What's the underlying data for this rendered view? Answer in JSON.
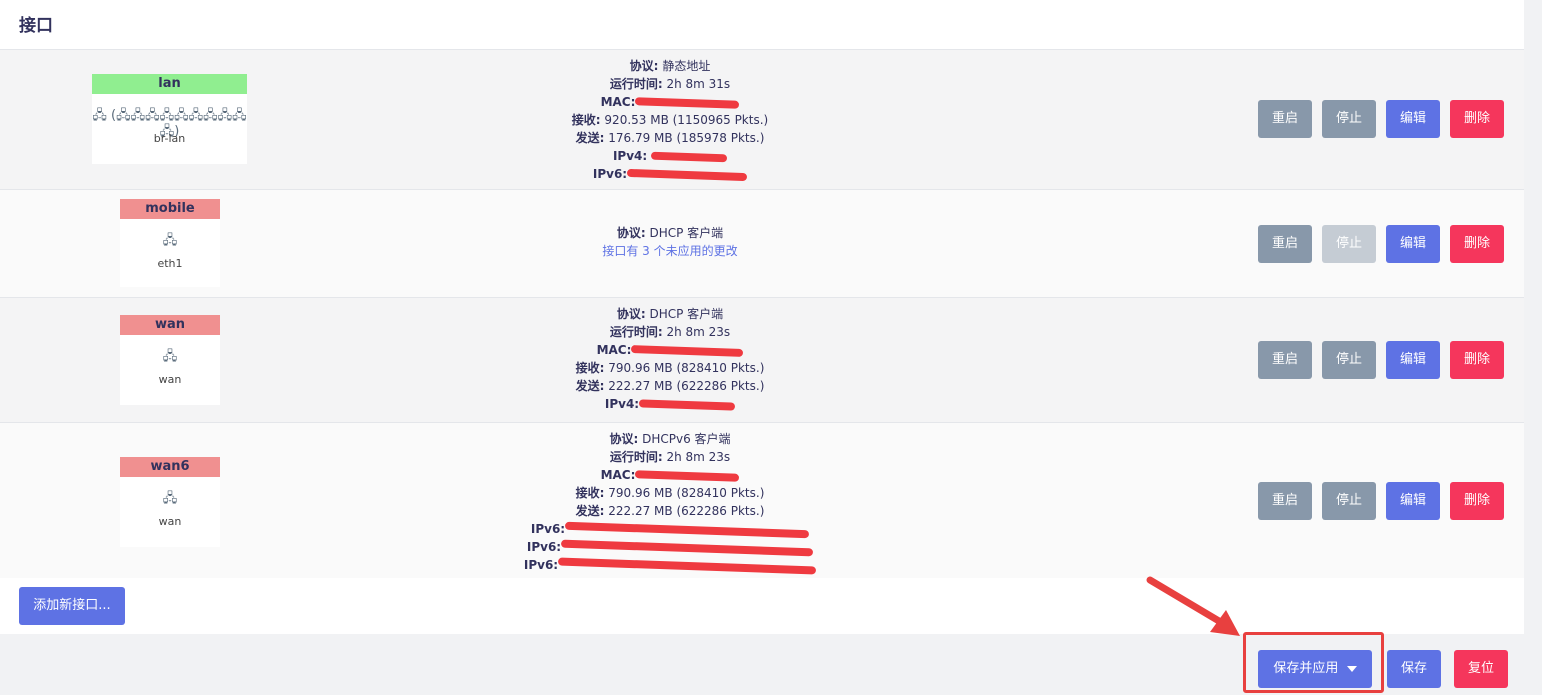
{
  "page": {
    "title": "接口"
  },
  "labels": {
    "protocol": "协议:",
    "uptime": "运行时间:",
    "mac": "MAC:",
    "rx": "接收:",
    "tx": "发送:",
    "ipv4": "IPv4:",
    "ipv6": "IPv6:"
  },
  "buttons": {
    "restart": "重启",
    "stop": "停止",
    "edit": "编辑",
    "delete": "删除"
  },
  "interfaces": [
    {
      "name": "lan",
      "header_color": "#90ee90",
      "device": "br-lan",
      "icon_text": "🖧 (🖧🖧🖧🖧🖧🖧🖧🖧🖧🖧)",
      "protocol": "静态地址",
      "uptime": "2h 8m 31s",
      "rx": "920.53 MB (1150965 Pkts.)",
      "tx": "176.79 MB (185978 Pkts.)"
    },
    {
      "name": "mobile",
      "header_color": "#f09090",
      "device": "eth1",
      "icon_text": "🖧",
      "protocol": "DHCP 客户端",
      "pending_note": "接口有 3 个未应用的更改"
    },
    {
      "name": "wan",
      "header_color": "#f09090",
      "device": "wan",
      "icon_text": "🖧",
      "protocol": "DHCP 客户端",
      "uptime": "2h 8m 23s",
      "rx": "790.96 MB (828410 Pkts.)",
      "tx": "222.27 MB (622286 Pkts.)"
    },
    {
      "name": "wan6",
      "header_color": "#f09090",
      "device": "wan",
      "icon_text": "🖧",
      "protocol": "DHCPv6 客户端",
      "uptime": "2h 8m 23s",
      "rx": "790.96 MB (828410 Pkts.)",
      "tx": "222.27 MB (622286 Pkts.)"
    }
  ],
  "footer": {
    "add_interface": "添加新接口...",
    "save_apply": "保存并应用",
    "save": "保存",
    "reset": "复位"
  },
  "colors": {
    "primary": "#5e72e4",
    "danger": "#f5365c",
    "secondary": "#8898aa",
    "annotation": "#e8403f"
  }
}
